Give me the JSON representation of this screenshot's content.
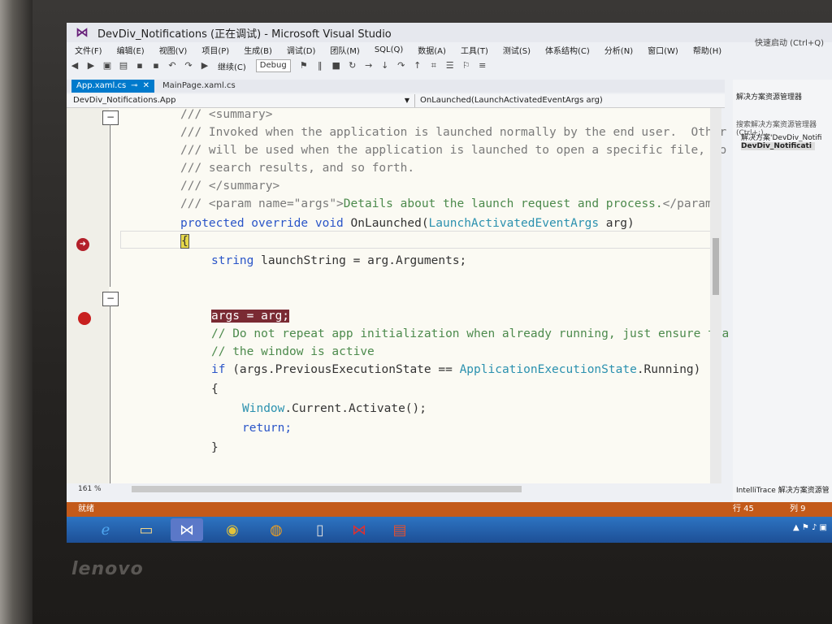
{
  "window": {
    "title": "DevDiv_Notifications (正在调试) - Microsoft Visual Studio",
    "quick_launch": "快速启动 (Ctrl+Q)"
  },
  "menu": [
    "文件(F)",
    "编辑(E)",
    "视图(V)",
    "项目(P)",
    "生成(B)",
    "调试(D)",
    "团队(M)",
    "SQL(Q)",
    "数据(A)",
    "工具(T)",
    "测试(S)",
    "体系结构(C)",
    "分析(N)",
    "窗口(W)",
    "帮助(H)"
  ],
  "toolbar": {
    "continue_label": "继续(C)",
    "config_value": "Debug"
  },
  "tabs": [
    {
      "label": "App.xaml.cs",
      "active": true
    },
    {
      "label": "MainPage.xaml.cs",
      "active": false
    }
  ],
  "navbar": {
    "class_dropdown": "DevDiv_Notifications.App",
    "member_dropdown": "OnLaunched(LaunchActivatedEventArgs arg)"
  },
  "code_lines": {
    "l1": "/// <summary>",
    "l2": "/// Invoked when the application is launched normally by the end user.  Other",
    "l3": "/// will be used when the application is launched to open a specific file, to",
    "l4": "/// search results, and so forth.",
    "l5": "/// </summary>",
    "l6a": "/// <param name=\"args\">",
    "l6b": "Details about the launch request and process.",
    "l6c": "</param>",
    "l7a": "protected override void ",
    "l7b": "OnLaunched(",
    "l7c": "LaunchActivatedEventArgs",
    "l7d": " arg)",
    "l8": "{",
    "l9a": "string",
    "l9b": " launchString = arg.Arguments;",
    "l10": "args = arg;",
    "l11": "// Do not repeat app initialization when already running, just ensure tha",
    "l12": "// the window is active",
    "l13a": "if",
    "l13b": " (args.PreviousExecutionState == ",
    "l13c": "ApplicationExecutionState",
    "l13d": ".Running)",
    "l14": "{",
    "l15a": "Window",
    "l15b": ".Current.Activate();",
    "l16": "return;",
    "l17": "}"
  },
  "editor_status": {
    "zoom": "161 %"
  },
  "statusbar": {
    "left": "就绪",
    "line": "行 45",
    "col": "列 9"
  },
  "solution_explorer": {
    "title": "解决方案资源管理器",
    "search": "搜索解决方案资源管理器(Ctrl+;)",
    "item1": "解决方案'DevDiv_Notifi",
    "item2": "DevDiv_Notificati",
    "footer_a": "IntelliTrace",
    "footer_b": "解决方案资源管"
  },
  "brand": "lenovo"
}
